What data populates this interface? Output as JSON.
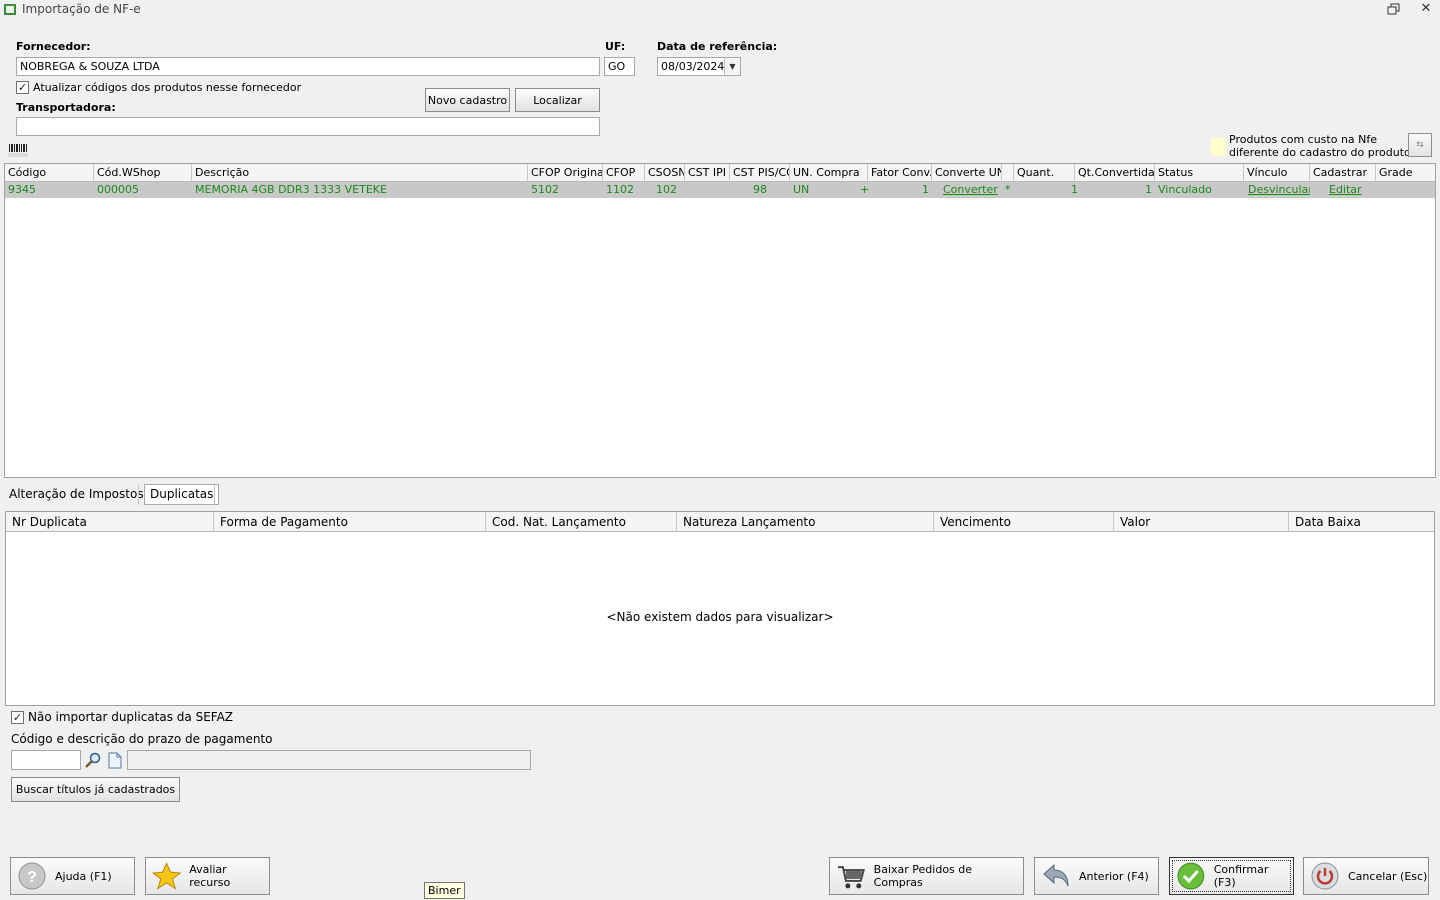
{
  "window": {
    "title": "Importação de NF-e"
  },
  "supplier": {
    "label": "Fornecedor:",
    "value": "NOBREGA & SOUZA LTDA",
    "uf_label": "UF:",
    "uf_value": "GO",
    "date_label": "Data de referência:",
    "date_value": "08/03/2024",
    "update_codes_label": "Atualizar códigos dos produtos nesse fornecedor",
    "update_codes_checked": true,
    "new_button": "Novo cadastro",
    "locate_button": "Localizar",
    "carrier_label": "Transportadora:",
    "carrier_value": ""
  },
  "legend": {
    "text1": "Produtos com custo na Nfe",
    "text2": "diferente do cadastro do produto",
    "color": "#ffffcc"
  },
  "products_grid": {
    "headers": [
      "Código",
      "Cód.WShop",
      "Descrição",
      "CFOP Original",
      "CFOP",
      "CSOSN",
      "CST IPI",
      "CST PIS/CO",
      "UN. Compra",
      "Fator Conv.",
      "Converte UN.",
      "",
      "Quant.",
      "Qt.Convertida",
      "Status",
      "Vínculo",
      "Cadastrar",
      "Grade"
    ],
    "rows": [
      {
        "codigo": "9345",
        "cod_wshop": "000005",
        "descricao": "MEMORIA 4GB DDR3 1333 VETEKE",
        "cfop_original": "5102",
        "cfop": "1102",
        "csosn": "102",
        "cst_ipi": "",
        "cst_pis": "98",
        "un_compra": "UN",
        "sign": "+",
        "fator": "1",
        "converte": "Converter",
        "flag": "*",
        "quant": "1",
        "qt_convertida": "1",
        "status": "Vinculado",
        "vinculo": "Desvincular",
        "cadastrar": "Editar",
        "grade": ""
      }
    ],
    "row_text_color": "#1a8a1a"
  },
  "tabs": [
    {
      "label": "Alteração de Impostos"
    },
    {
      "label": "Duplicatas"
    }
  ],
  "duplicates_grid": {
    "headers": [
      "Nr Duplicata",
      "Forma de Pagamento",
      "Cod. Nat. Lançamento",
      "Natureza Lançamento",
      "Vencimento",
      "Valor",
      "Data Baixa"
    ],
    "empty_message": "<Não existem dados para visualizar>"
  },
  "payment": {
    "no_import_label": "Não importar duplicatas da SEFAZ",
    "no_import_checked": true,
    "term_label": "Código e descrição do prazo de pagamento",
    "term_code": "",
    "term_desc": "",
    "search_button": "Buscar títulos já cadastrados"
  },
  "footer": {
    "help": "Ajuda (F1)",
    "rate": "Avaliar recurso",
    "orders": "Baixar Pedidos de Compras",
    "previous": "Anterior (F4)",
    "confirm": "Confirmar (F3)",
    "cancel": "Cancelar (Esc)",
    "tooltip": "Bimer"
  }
}
